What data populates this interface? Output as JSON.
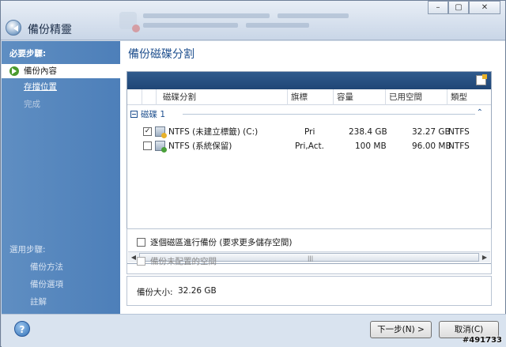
{
  "window": {
    "title": "備份精靈",
    "buttons": {
      "minimize": "–",
      "maximize": "▢",
      "close": "✕"
    }
  },
  "sidebar": {
    "required_header": "必要步驟:",
    "required_steps": [
      {
        "label": "備份內容",
        "state": "active"
      },
      {
        "label": "存擋位置",
        "state": "link"
      },
      {
        "label": "完成",
        "state": "disabled"
      }
    ],
    "optional_header": "選用步驟:",
    "optional_steps": [
      {
        "label": "備份方法"
      },
      {
        "label": "備份選項"
      },
      {
        "label": "註解"
      }
    ]
  },
  "main": {
    "title": "備份磁碟分割",
    "table": {
      "columns": [
        "磁碟分割",
        "旗標",
        "容量",
        "已用空間",
        "類型"
      ],
      "group_label": "磁碟 1",
      "group_caret": "⌃",
      "rows": [
        {
          "checked": true,
          "name": "NTFS (未建立標籤) (C:)",
          "flag": "Pri",
          "capacity": "238.4 GB",
          "used": "32.27 GB",
          "type": "NTFS",
          "check_mark": "✓"
        },
        {
          "checked": false,
          "name": "NTFS (系統保留)",
          "flag": "Pri,Act.",
          "capacity": "100 MB",
          "used": "96.00 MB",
          "type": "NTFS",
          "check_mark": ""
        }
      ],
      "scroll_left": "◀",
      "scroll_right": "▶",
      "scroll_grip": "|||"
    },
    "options": {
      "sector_by_sector": "逐個磁區進行備份 (要求更多儲存空間)",
      "backup_unallocated": "備份未配置的空間"
    },
    "size": {
      "label": "備份大小:",
      "value": "32.26 GB"
    }
  },
  "footer": {
    "help_glyph": "?",
    "next_button": "下一步(N) >",
    "cancel_button": "取消(C)"
  },
  "watermark": "#491733",
  "colors": {
    "sidebar_blue": "#4d7fb9",
    "toolbar_navy": "#1f4676",
    "title_blue": "#1e4f8e"
  }
}
